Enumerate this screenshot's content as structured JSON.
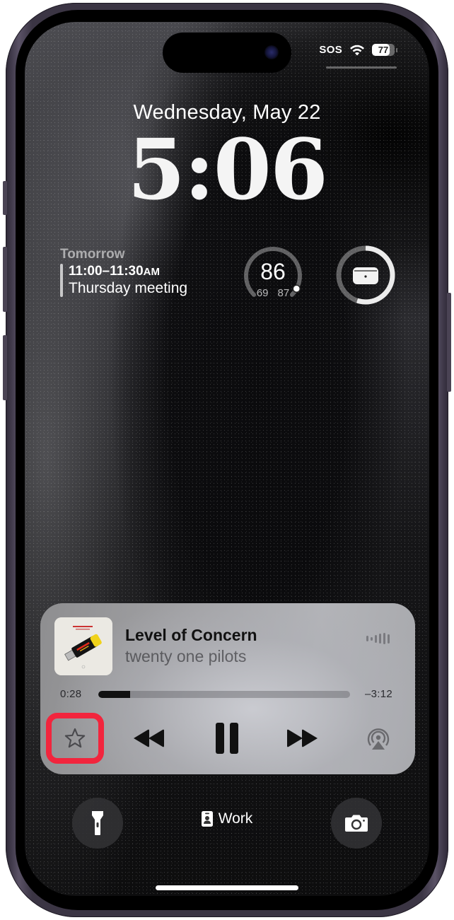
{
  "status_bar": {
    "carrier": "SOS",
    "wifi_icon": "wifi-icon",
    "battery_percent": 77
  },
  "lock_screen": {
    "date": "Wednesday, May 22",
    "time": "5:06"
  },
  "widgets": {
    "calendar": {
      "day": "Tomorrow",
      "time_range": "11:00–11:30",
      "ampm": "AM",
      "title": "Thursday meeting"
    },
    "weather": {
      "current": "86",
      "low": "69",
      "high": "87",
      "position_fraction": 0.94
    },
    "airpods": {
      "icon": "airpods-case-icon",
      "battery_fraction": 0.55
    }
  },
  "now_playing": {
    "title": "Level of Concern",
    "artist": "twenty one pilots",
    "elapsed": "0:28",
    "remaining": "–3:12",
    "progress_fraction": 0.127,
    "controls": {
      "favorite": "star-icon",
      "previous": "backward-icon",
      "play_pause": "pause-icon",
      "next": "forward-icon",
      "output": "airplay-icon"
    },
    "highlight_color": "#f2253d"
  },
  "bottom": {
    "flashlight": "flashlight-icon",
    "focus_label": "Work",
    "focus_icon": "id-badge-icon",
    "camera": "camera-icon"
  }
}
